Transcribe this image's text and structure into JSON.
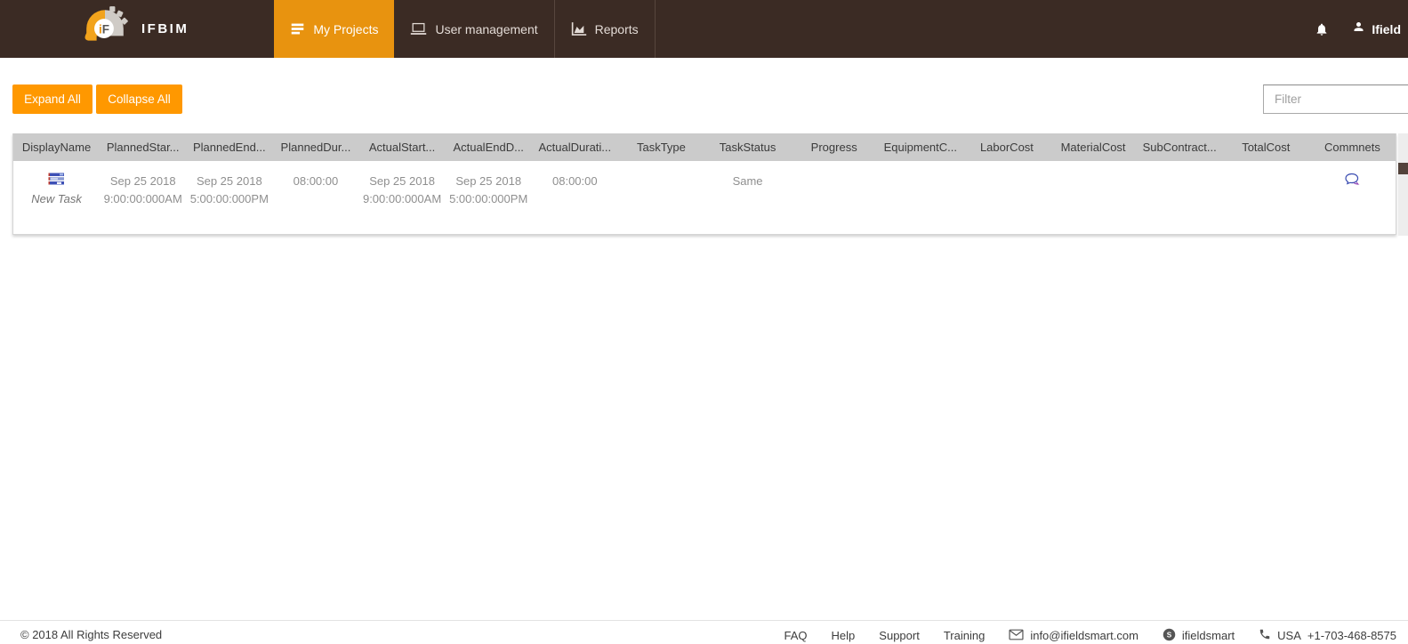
{
  "navbar": {
    "brand": "IFBIM",
    "tabs": [
      {
        "label": "My Projects",
        "active": true
      },
      {
        "label": "User management",
        "active": false
      },
      {
        "label": "Reports",
        "active": false
      }
    ],
    "user_label": "Ifield"
  },
  "toolbar": {
    "expand_all_label": "Expand All",
    "collapse_all_label": "Collapse All",
    "filter_placeholder": "Filter"
  },
  "table": {
    "columns": [
      "DisplayName",
      "PlannedStar...",
      "PlannedEnd...",
      "PlannedDur...",
      "ActualStart...",
      "ActualEndD...",
      "ActualDurati...",
      "TaskType",
      "TaskStatus",
      "Progress",
      "EquipmentC...",
      "LaborCost",
      "MaterialCost",
      "SubContract...",
      "TotalCost",
      "Commnets"
    ],
    "row": {
      "display_name": "New Task",
      "planned_start_date": "Sep 25 2018",
      "planned_start_time": "9:00:00:000AM",
      "planned_end_date": "Sep 25 2018",
      "planned_end_time": "5:00:00:000PM",
      "planned_duration": "08:00:00",
      "actual_start_date": "Sep 25 2018",
      "actual_start_time": "9:00:00:000AM",
      "actual_end_date": "Sep 25 2018",
      "actual_end_time": "5:00:00:000PM",
      "actual_duration": "08:00:00",
      "task_type": "",
      "task_status": "Same",
      "progress": "",
      "equipment_cost": "",
      "labor_cost": "",
      "material_cost": "",
      "sub_contract_cost": "",
      "total_cost": ""
    }
  },
  "footer": {
    "copyright": "© 2018 All Rights Reserved",
    "links": [
      "FAQ",
      "Help",
      "Support",
      "Training"
    ],
    "email": "info@ifieldsmart.com",
    "skype": "ifieldsmart",
    "phone_label": "USA",
    "phone_number": "+1-703-468-8575"
  },
  "icons": {
    "brand": "hardhat-logo",
    "my_projects": "list-icon",
    "user_management": "laptop-icon",
    "reports": "area-chart-icon",
    "notifications": "bell-icon",
    "user": "person-icon",
    "task_row": "task-bars-icon",
    "comments": "chat-bubble-icon",
    "email": "envelope-icon",
    "skype": "skype-icon",
    "phone": "phone-icon"
  },
  "colors": {
    "navbar_bg": "#3B2B24",
    "active_tab": "#E8930F",
    "button_orange": "#FF9800",
    "table_header_bg": "#CBCBCB",
    "row_icon_blue": "#3D50B5"
  }
}
